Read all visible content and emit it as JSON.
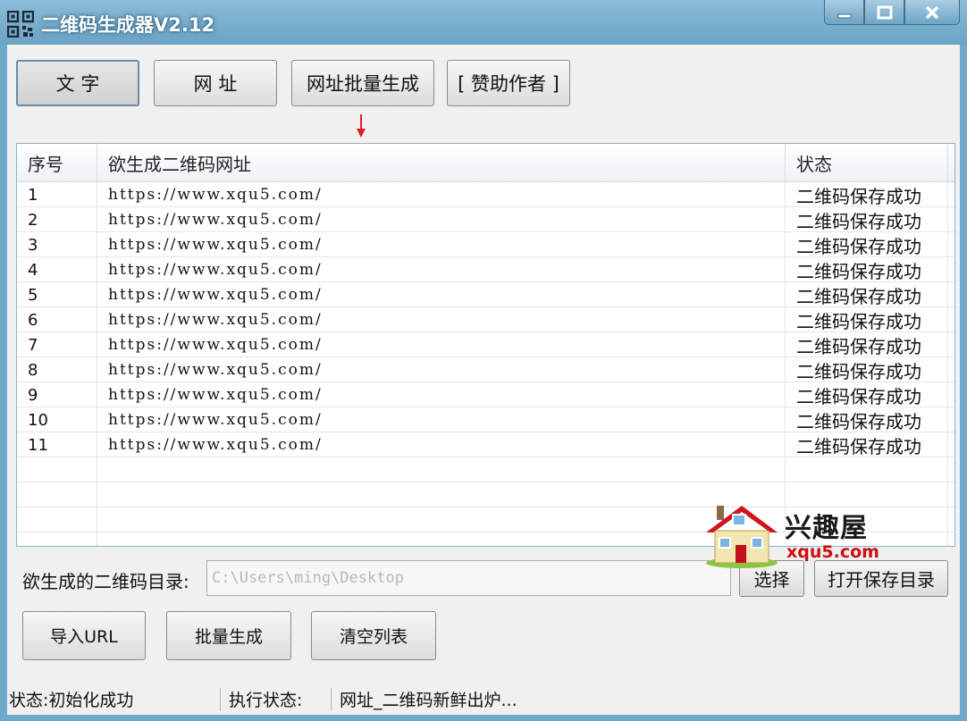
{
  "window": {
    "title": "二维码生成器V2.12",
    "controls": [
      "minimize",
      "maximize",
      "close"
    ]
  },
  "toolbar": {
    "tabs": [
      {
        "label": "文  字",
        "active": true
      },
      {
        "label": "网  址",
        "active": false
      },
      {
        "label": "网址批量生成",
        "active": false
      },
      {
        "label": "[ 赞助作者 ]",
        "active": false
      }
    ]
  },
  "table": {
    "columns": [
      "序号",
      "欲生成二维码网址",
      "状态"
    ],
    "rows": [
      {
        "index": "1",
        "url": "https://www.xqu5.com/",
        "status": "二维码保存成功"
      },
      {
        "index": "2",
        "url": "https://www.xqu5.com/",
        "status": "二维码保存成功"
      },
      {
        "index": "3",
        "url": "https://www.xqu5.com/",
        "status": "二维码保存成功"
      },
      {
        "index": "4",
        "url": "https://www.xqu5.com/",
        "status": "二维码保存成功"
      },
      {
        "index": "5",
        "url": "https://www.xqu5.com/",
        "status": "二维码保存成功"
      },
      {
        "index": "6",
        "url": "https://www.xqu5.com/",
        "status": "二维码保存成功"
      },
      {
        "index": "7",
        "url": "https://www.xqu5.com/",
        "status": "二维码保存成功"
      },
      {
        "index": "8",
        "url": "https://www.xqu5.com/",
        "status": "二维码保存成功"
      },
      {
        "index": "9",
        "url": "https://www.xqu5.com/",
        "status": "二维码保存成功"
      },
      {
        "index": "10",
        "url": "https://www.xqu5.com/",
        "status": "二维码保存成功"
      },
      {
        "index": "11",
        "url": "https://www.xqu5.com/",
        "status": "二维码保存成功"
      }
    ]
  },
  "directory": {
    "label": "欲生成的二维码目录:",
    "value": "C:\\Users\\ming\\Desktop",
    "choose_label": "选择",
    "open_label": "打开保存目录"
  },
  "actions": {
    "import_label": "导入URL",
    "batch_label": "批量生成",
    "clear_label": "清空列表"
  },
  "statusbar": {
    "status": "状态:初始化成功",
    "exec_label": "执行状态:",
    "message": "网址_二维码新鲜出炉..."
  },
  "watermark": {
    "name": "兴趣屋",
    "domain": "xqu5.com"
  },
  "colors": {
    "titlebar": "#6fa8c8",
    "arrow": "#e02020",
    "watermark_domain": "#cc1010"
  },
  "icons": [
    "qr-code-icon",
    "minimize-icon",
    "maximize-icon",
    "close-icon",
    "down-arrow-icon",
    "house-logo-icon"
  ]
}
